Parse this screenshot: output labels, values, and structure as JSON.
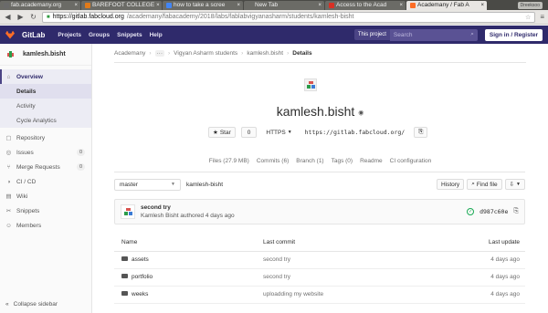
{
  "browser": {
    "tabs": [
      {
        "label": "fab.academany.org",
        "active": false,
        "fav_color": "#6a6a6a"
      },
      {
        "label": "BAREFOOT COLLEGE",
        "active": false,
        "fav_color": "#e07a1a"
      },
      {
        "label": "how to take a scree",
        "active": false,
        "fav_color": "#4285f4"
      },
      {
        "label": "New Tab",
        "active": false,
        "fav_color": ""
      },
      {
        "label": "Access to the Acad",
        "active": false,
        "fav_color": "#d93025"
      },
      {
        "label": "Academany / Fab A",
        "active": true,
        "fav_color": "#fc6d26"
      }
    ],
    "user_badge": "Dreeksoo",
    "url_host": "https://gitlab.fabcloud.org",
    "url_path": "/academany/fabacademy/2018/labs/fablabvigyanasharm/students/kamlesh-bisht"
  },
  "header": {
    "brand": "GitLab",
    "nav": [
      "Projects",
      "Groups",
      "Snippets",
      "Help"
    ],
    "this_project": "This project",
    "search_placeholder": "Search",
    "signin": "Sign in / Register"
  },
  "sidebar": {
    "project_name": "kamlesh.bisht",
    "overview": "Overview",
    "overview_items": [
      "Details",
      "Activity",
      "Cycle Analytics"
    ],
    "items": [
      {
        "label": "Repository",
        "icon": "repository-icon",
        "glyph": "▢",
        "badge": ""
      },
      {
        "label": "Issues",
        "icon": "issues-icon",
        "glyph": "◎",
        "badge": "0"
      },
      {
        "label": "Merge Requests",
        "icon": "merge-icon",
        "glyph": "⑂",
        "badge": "0"
      },
      {
        "label": "CI / CD",
        "icon": "ci-icon",
        "glyph": "◑",
        "badge": ""
      },
      {
        "label": "Wiki",
        "icon": "wiki-icon",
        "glyph": "▤",
        "badge": ""
      },
      {
        "label": "Snippets",
        "icon": "snippets-icon",
        "glyph": "✂",
        "badge": ""
      },
      {
        "label": "Members",
        "icon": "members-icon",
        "glyph": "☺",
        "badge": ""
      }
    ],
    "collapse": "Collapse sidebar"
  },
  "breadcrumb": {
    "items": [
      "Academany",
      "···",
      "Vigyan Asharm students",
      "kamlesh.bisht"
    ],
    "current": "Details"
  },
  "project": {
    "title": "kamlesh.bisht",
    "star_label": "Star",
    "star_count": "0",
    "protocol": "HTTPS",
    "clone_url": "https://gitlab.fabcloud.org/",
    "stats": [
      "Files (27.9 MB)",
      "Commits (6)",
      "Branch (1)",
      "Tags (0)",
      "Readme",
      "CI configuration"
    ]
  },
  "toolbar": {
    "branch": "master",
    "path": "kamlesh-bisht",
    "history": "History",
    "find_file": "Find file"
  },
  "last_commit": {
    "message": "second try",
    "meta": "Kamlesh Bisht authored 4 days ago",
    "sha": "d987c60e"
  },
  "files": {
    "headers": [
      "Name",
      "Last commit",
      "Last update"
    ],
    "rows": [
      {
        "name": "assets",
        "commit": "second try",
        "updated": "4 days ago"
      },
      {
        "name": "portfolio",
        "commit": "second try",
        "updated": "4 days ago"
      },
      {
        "name": "weeks",
        "commit": "uploadding my website",
        "updated": "4 days ago"
      }
    ]
  }
}
